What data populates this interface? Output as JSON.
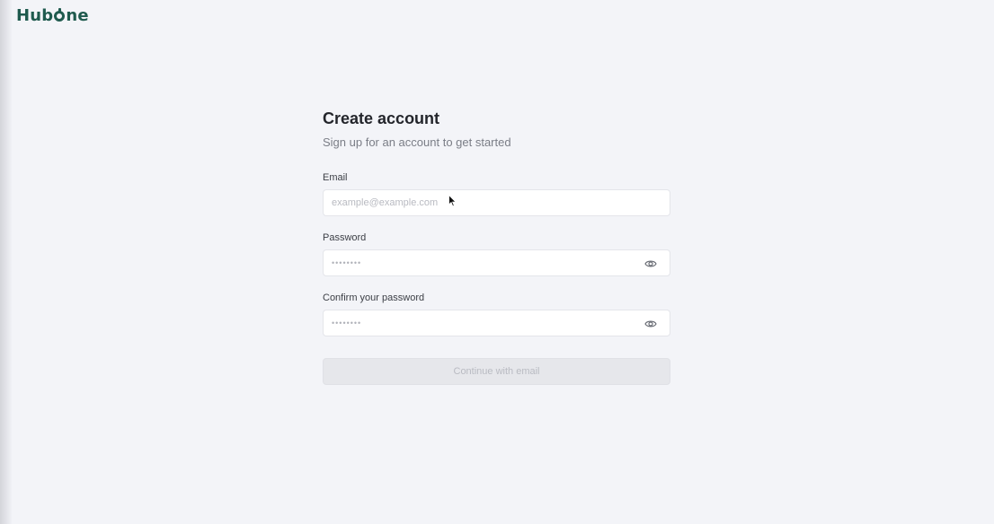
{
  "brand": {
    "name_prefix": "Hub",
    "name_suffix": "ne"
  },
  "signup": {
    "title": "Create account",
    "subtitle": "Sign up for an account to get started",
    "email_label": "Email",
    "email_placeholder": "example@example.com",
    "email_value": "",
    "password_label": "Password",
    "password_placeholder": "••••••••",
    "password_value": "",
    "confirm_label": "Confirm your password",
    "confirm_placeholder": "••••••••",
    "confirm_value": "",
    "continue_label": "Continue with email"
  },
  "icons": {
    "password_toggle": "eye-icon",
    "confirm_toggle": "eye-icon",
    "cursor": "mouse-pointer-icon"
  },
  "colors": {
    "brand": "#1f5a4e",
    "background": "#f3f4f8",
    "button_disabled_bg": "#e6e7eb",
    "button_disabled_text": "#b9bbc2"
  }
}
